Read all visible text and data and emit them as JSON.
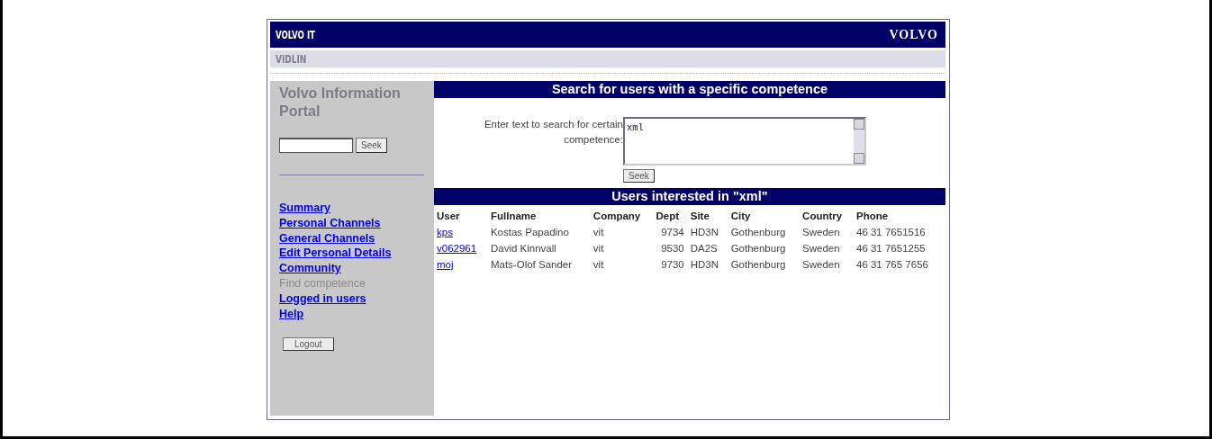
{
  "header": {
    "brand": "VOLVO IT",
    "logo": "VOLVO"
  },
  "subheader": {
    "title": "VIDLIN"
  },
  "sidebar": {
    "title": "Volvo Information Portal",
    "search_button": "Seek",
    "nav": [
      {
        "label": "Summary",
        "selected": false
      },
      {
        "label": "Personal Channels",
        "selected": false
      },
      {
        "label": "General Channels",
        "selected": false
      },
      {
        "label": "Edit Personal Details",
        "selected": false
      },
      {
        "label": "Community",
        "selected": false
      },
      {
        "label": "Find competence",
        "selected": true
      },
      {
        "label": "Logged in users",
        "selected": false
      },
      {
        "label": "Help",
        "selected": false
      }
    ],
    "logout_button": "Logout"
  },
  "search": {
    "heading": "Search for users with a specific competence",
    "label": "Enter text to search for certain competence:",
    "value": "xml",
    "button": "Seek"
  },
  "results": {
    "heading": "Users interested in \"xml\"",
    "columns": [
      "User",
      "Fullname",
      "Company",
      "Dept",
      "Site",
      "City",
      "Country",
      "Phone"
    ],
    "rows": [
      [
        "kps",
        "Kostas Papadino",
        "vit",
        "9734",
        "HD3N",
        "Gothenburg",
        "Sweden",
        "46 31 7651516"
      ],
      [
        "v062961",
        "David Kinnvall",
        "vit",
        "9530",
        "DA2S",
        "Gothenburg",
        "Sweden",
        "46 31 7651255"
      ],
      [
        "moj",
        "Mats-Olof Sander",
        "vit",
        "9730",
        "HD3N",
        "Gothenburg",
        "Sweden",
        "46 31 765 7656"
      ]
    ]
  }
}
